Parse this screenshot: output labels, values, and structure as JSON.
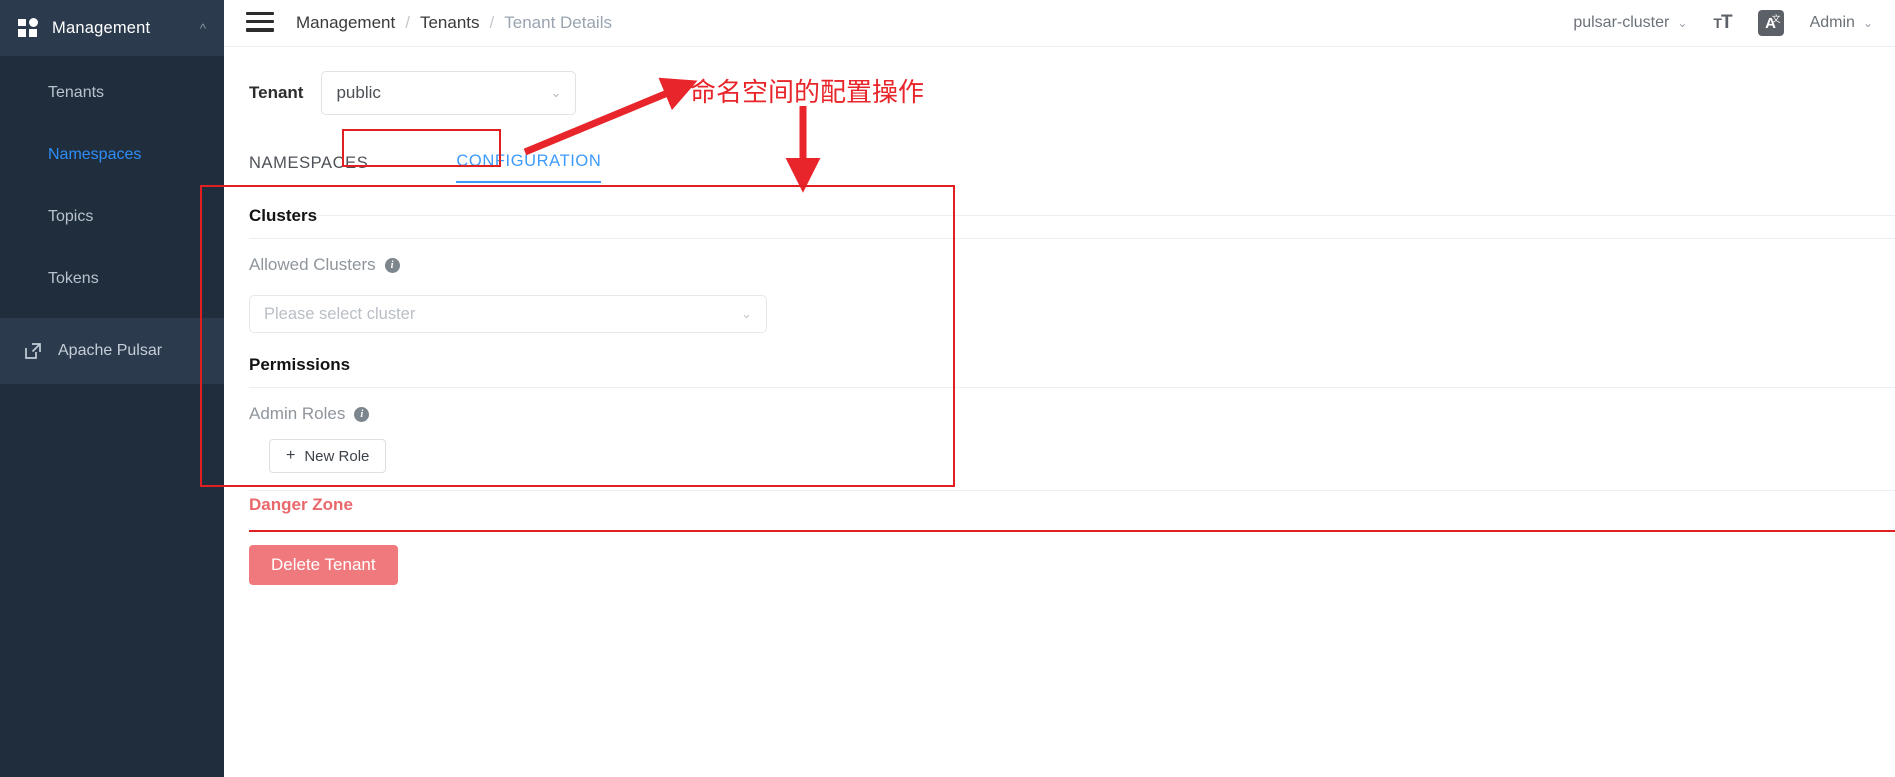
{
  "sidebar": {
    "header": {
      "title": "Management",
      "icon": "grid-icon",
      "chevron": "chevron-up-icon"
    },
    "items": [
      {
        "label": "Tenants",
        "active": false
      },
      {
        "label": "Namespaces",
        "active": true
      },
      {
        "label": "Topics",
        "active": false
      },
      {
        "label": "Tokens",
        "active": false
      }
    ],
    "external": {
      "label": "Apache Pulsar",
      "icon": "external-link-icon"
    }
  },
  "header": {
    "menu_icon": "hamburger-icon",
    "breadcrumb": [
      {
        "label": "Management",
        "current": false
      },
      {
        "label": "Tenants",
        "current": false
      },
      {
        "label": "Tenant Details",
        "current": true
      }
    ],
    "separator": "/",
    "cluster_selector": {
      "label": "pulsar-cluster",
      "chevron": "⌄"
    },
    "font_size_icon": {
      "small": "T",
      "large": "T"
    },
    "language_icon": {
      "letter": "A",
      "sup": "文"
    },
    "user": {
      "label": "Admin",
      "chevron": "⌄"
    }
  },
  "main": {
    "tenant": {
      "label": "Tenant",
      "value": "public",
      "chevron": "⌄"
    },
    "tabs": [
      {
        "label": "NAMESPACES",
        "active": false
      },
      {
        "label": "CONFIGURATION",
        "active": true
      }
    ],
    "clusters": {
      "section_title": "Clusters",
      "field_label": "Allowed Clusters",
      "info_icon": "info-icon",
      "select_placeholder": "Please select cluster",
      "chevron": "⌄"
    },
    "permissions": {
      "section_title": "Permissions",
      "field_label": "Admin Roles",
      "info_icon": "info-icon",
      "new_role_button": "New Role",
      "plus_icon": "+"
    },
    "danger": {
      "title": "Danger Zone",
      "delete_button": "Delete Tenant"
    }
  },
  "annotations": {
    "text": "命名空间的配置操作",
    "color": "#e8252a",
    "arrow_diagonal": "arrow-up-right-icon",
    "arrow_down": "arrow-down-icon",
    "highlight_boxes": [
      "configuration-tab",
      "configuration-panel"
    ]
  },
  "colors": {
    "sidebar_bg": "#1f2d3d",
    "sidebar_head_bg": "#2b3a4d",
    "accent_blue": "#3d9bfb",
    "annotation_red": "#e02020",
    "danger_red": "#e9686b",
    "delete_btn": "#f0797d"
  }
}
